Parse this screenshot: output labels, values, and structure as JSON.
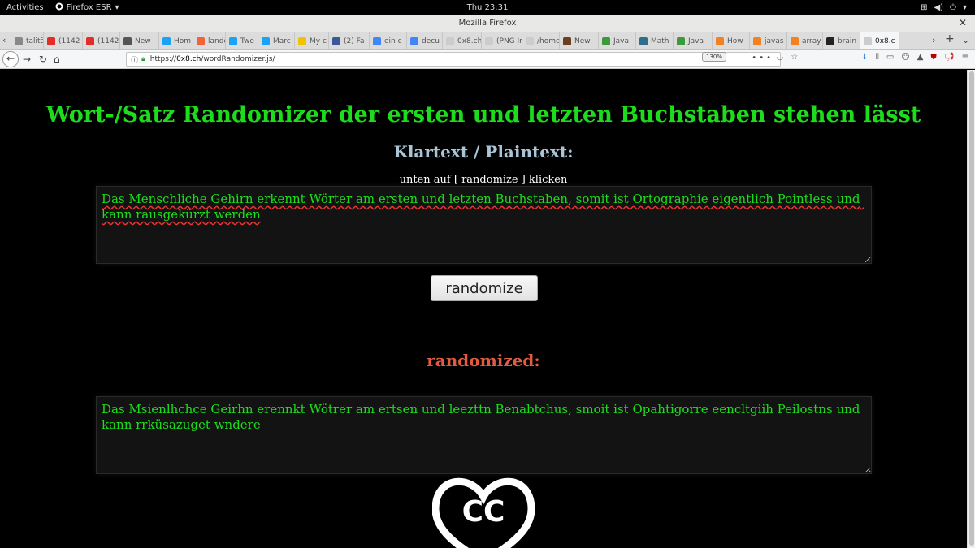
{
  "system": {
    "activities": "Activities",
    "app_name": "Firefox ESR",
    "clock": "Thu 23:31"
  },
  "window": {
    "title": "Mozilla Firefox"
  },
  "tabs": [
    {
      "label": "talitär",
      "color": "#888888"
    },
    {
      "label": "(1142",
      "color": "#e52d27"
    },
    {
      "label": "(1142",
      "color": "#e52d27"
    },
    {
      "label": "New",
      "color": "#555555"
    },
    {
      "label": "Hom",
      "color": "#1da1f2"
    },
    {
      "label": "lande",
      "color": "#f0643c"
    },
    {
      "label": "Twe",
      "color": "#1da1f2"
    },
    {
      "label": "Marc",
      "color": "#1da1f2"
    },
    {
      "label": "My c",
      "color": "#f2c200"
    },
    {
      "label": "(2) Fa",
      "color": "#3b5998"
    },
    {
      "label": "ein c",
      "color": "#4285f4"
    },
    {
      "label": "decu",
      "color": "#4285f4"
    },
    {
      "label": "0x8.ch/",
      "color": "#cccccc"
    },
    {
      "label": "(PNG Im",
      "color": "#cccccc"
    },
    {
      "label": "/home/",
      "color": "#cccccc"
    },
    {
      "label": "New",
      "color": "#6b3f1f"
    },
    {
      "label": "Java",
      "color": "#3c9a3c"
    },
    {
      "label": "Math",
      "color": "#2e6f8e"
    },
    {
      "label": "Java",
      "color": "#3c9a3c"
    },
    {
      "label": "How",
      "color": "#f48024"
    },
    {
      "label": "javas",
      "color": "#f48024"
    },
    {
      "label": "array",
      "color": "#f48024"
    },
    {
      "label": "brain",
      "color": "#222222"
    },
    {
      "label": "0x8.c",
      "color": "#cccccc"
    }
  ],
  "navbar": {
    "url_prefix": "https://",
    "url_domain": "0x8.ch",
    "url_path": "/wordRandomizer.js/",
    "zoom": "130%",
    "page_actions": "•••"
  },
  "page": {
    "title": "Wort-/Satz Randomizer der ersten und letzten Buchstaben stehen lässt",
    "plaintext_heading": "Klartext / Plaintext:",
    "hint": "unten auf [ randomize ] klicken",
    "plaintext_value": "Das Menschliche Gehirn erkennt Wörter am ersten und letzten Buchstaben, somit ist Ortographie eigentlich Pointless und kann rausgekürzt werden",
    "button_label": "randomize",
    "result_heading": "randomized:",
    "result_value": "Das Msienlhchce Geirhn erennkt Wötrer am ertsen und leezttn Benabtchus, smoit ist Opahtigorre eencltgiih Peilostns und kann rrküsazuget wndere",
    "logo_text": "CC"
  },
  "colors": {
    "title_green": "#1cdc1c",
    "heading_blue": "#a9c5d6",
    "heading_red": "#e25a3f"
  }
}
